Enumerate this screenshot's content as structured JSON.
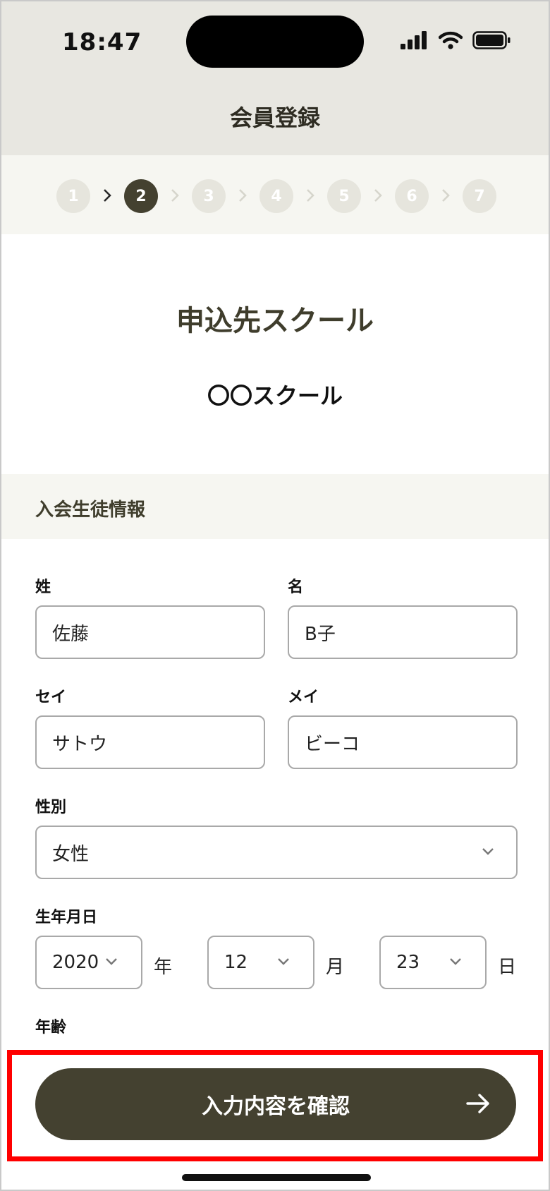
{
  "status_bar": {
    "time": "18:47"
  },
  "header": {
    "title": "会員登録"
  },
  "stepper": {
    "current": 2,
    "steps": [
      "1",
      "2",
      "3",
      "4",
      "5",
      "6",
      "7"
    ]
  },
  "school": {
    "title": "申込先スクール",
    "name": "〇〇スクール"
  },
  "section": {
    "title": "入会生徒情報"
  },
  "form": {
    "last_name": {
      "label": "姓",
      "value": "佐藤"
    },
    "first_name": {
      "label": "名",
      "value": "B子"
    },
    "last_name_kana": {
      "label": "セイ",
      "value": "サトウ"
    },
    "first_name_kana": {
      "label": "メイ",
      "value": "ビーコ"
    },
    "gender": {
      "label": "性別",
      "value": "女性"
    },
    "birthday": {
      "label": "生年月日",
      "year": "2020",
      "year_unit": "年",
      "month": "12",
      "month_unit": "月",
      "day": "23",
      "day_unit": "日"
    },
    "age": {
      "label": "年齢"
    }
  },
  "footer": {
    "confirm_label": "入力内容を確認"
  },
  "colors": {
    "accent": "#444130",
    "highlight": "#ff0000",
    "header_bg": "#e8e7e1",
    "band_bg": "#f6f6f1"
  }
}
